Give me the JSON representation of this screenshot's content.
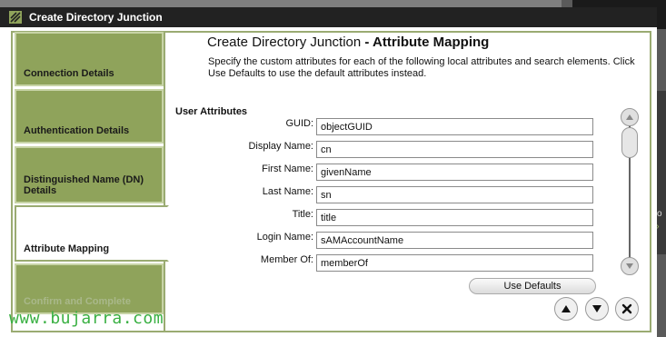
{
  "window": {
    "title": "Create Directory Junction"
  },
  "background": {
    "snippet": "tio",
    "chevrons": "»"
  },
  "nav": {
    "items": [
      {
        "label": "Connection Details",
        "state": "normal"
      },
      {
        "label": "Authentication Details",
        "state": "normal"
      },
      {
        "label": "Distinguished Name (DN) Details",
        "state": "normal"
      },
      {
        "label": "Attribute Mapping",
        "state": "active"
      },
      {
        "label": "Confirm and Complete",
        "state": "disabled"
      }
    ]
  },
  "main": {
    "heading_prefix": "Create Directory Junction",
    "heading_bold": "- Attribute Mapping",
    "description": "Specify the custom attributes for each of the following local attributes and search elements. Click Use Defaults to use the default attributes instead.",
    "section_title": "User Attributes",
    "fields": [
      {
        "label": "GUID:",
        "value": "objectGUID"
      },
      {
        "label": "Display Name:",
        "value": "cn"
      },
      {
        "label": "First Name:",
        "value": "givenName"
      },
      {
        "label": "Last Name:",
        "value": "sn"
      },
      {
        "label": "Title:",
        "value": "title"
      },
      {
        "label": "Login Name:",
        "value": "sAMAccountName"
      },
      {
        "label": "Member Of:",
        "value": "memberOf"
      }
    ],
    "use_defaults_label": "Use Defaults"
  },
  "icons": {
    "scroll_up": "chevron-up-icon",
    "scroll_down": "chevron-down-icon",
    "nav_up": "arrow-up-icon",
    "nav_down": "arrow-down-icon",
    "close": "close-icon"
  },
  "colors": {
    "accent_green": "#8fa35b",
    "frame_green": "#9aab72",
    "titlebar": "#222222",
    "watermark": "#3ab043"
  },
  "watermark": "www.bujarra.com"
}
